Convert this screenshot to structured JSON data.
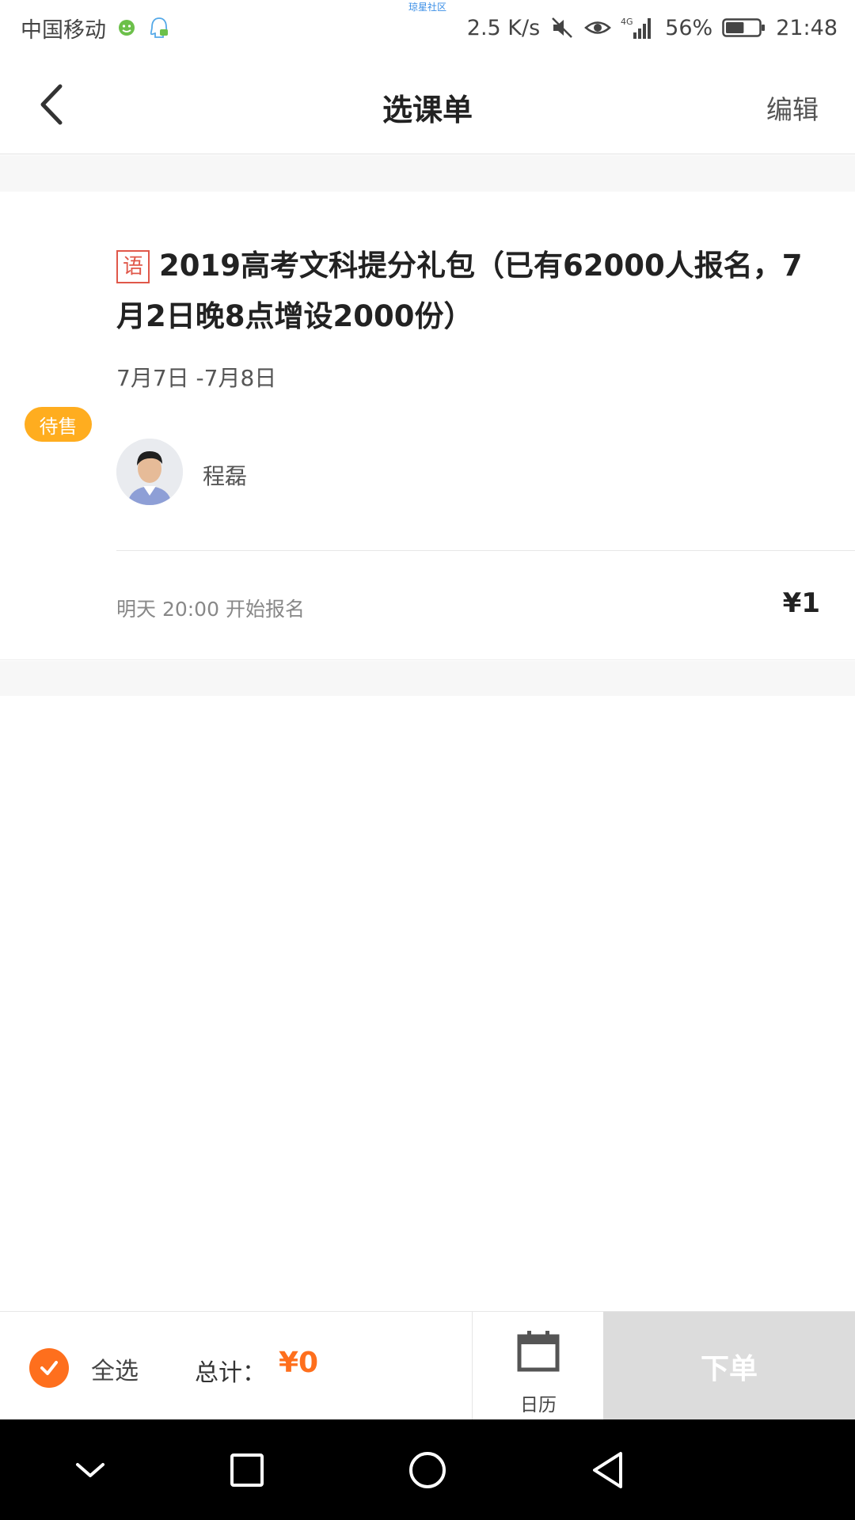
{
  "status_bar": {
    "carrier": "中国移动",
    "center_label": "琼星社区",
    "network_speed": "2.5 K/s",
    "network_type": "4G",
    "battery_percent": "56%",
    "battery_level": 0.56,
    "time": "21:48"
  },
  "header": {
    "title": "选课单",
    "edit_label": "编辑"
  },
  "course": {
    "status_badge": "待售",
    "subject_tag": "语",
    "title": "2019高考文科提分礼包（已有62000人报名，7月2日晚8点增设2000份）",
    "date_range": "7月7日 -7月8日",
    "teacher_name": "程磊",
    "enroll_text": "明天 20:00 开始报名",
    "price": "¥1"
  },
  "bottom_bar": {
    "select_all_label": "全选",
    "select_all_checked": true,
    "total_label": "总计：",
    "total_value": "¥0",
    "calendar_label": "日历",
    "order_label": "下单"
  },
  "colors": {
    "accent_orange": "#fe6f1d",
    "badge_yellow": "#ffad1f",
    "subject_red": "#e0584a",
    "order_disabled": "#dcdcdc"
  },
  "icons": {
    "back": "chevron-left-icon",
    "calendar": "calendar-icon",
    "check": "check-icon"
  }
}
